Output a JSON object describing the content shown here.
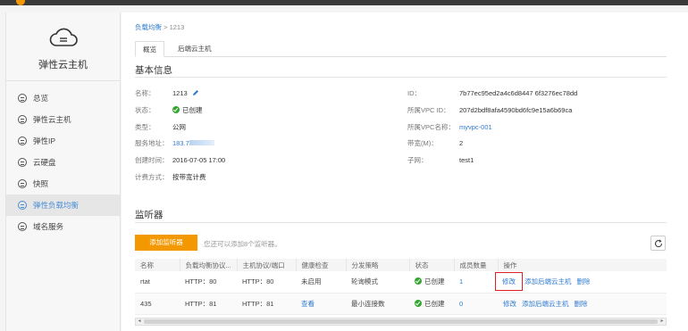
{
  "sidebar": {
    "title": "弹性云主机",
    "items": [
      {
        "label": "总览",
        "icon": "overview-icon"
      },
      {
        "label": "弹性云主机",
        "icon": "server-icon"
      },
      {
        "label": "弹性IP",
        "icon": "ip-icon"
      },
      {
        "label": "云硬盘",
        "icon": "disk-icon"
      },
      {
        "label": "快照",
        "icon": "snapshot-icon"
      },
      {
        "label": "弹性负载均衡",
        "icon": "load-balancer-icon",
        "active": true
      },
      {
        "label": "域名服务",
        "icon": "dns-icon"
      }
    ]
  },
  "breadcrumb": {
    "link": "负载均衡",
    "sep": " > ",
    "current": "1213"
  },
  "tabs": [
    {
      "label": "概览",
      "active": true
    },
    {
      "label": "后端云主机"
    }
  ],
  "basic_info": {
    "title": "基本信息",
    "name_k": "名称：",
    "name_v": "1213",
    "status_k": "状态：",
    "status_v": "已创建",
    "type_k": "类型：",
    "type_v": "公网",
    "addr_k": "服务地址：",
    "addr_v": "183.7",
    "created_k": "创建时间：",
    "created_v": "2016-07-05 17:00",
    "billing_k": "计费方式：",
    "billing_v": "按带宽计费",
    "id_k": "ID：",
    "id_v": "7b77ec95ed2a4c6d8447 6f3276ec78dd",
    "vpcid_k": "所属VPC ID：",
    "vpcid_v": "207d2bdf8afa4590bd6fc9e15a6b69ca",
    "vpcname_k": "所属VPC名称：",
    "vpcname_v": "myvpc-001",
    "bw_k": "带宽(M)：",
    "bw_v": "2",
    "subnet_k": "子网：",
    "subnet_v": "test1"
  },
  "listener": {
    "title": "监听器",
    "add_button": "添加监听器",
    "hint": "您还可以添加8个监听器。",
    "columns": [
      "名称",
      "负载均衡协议...",
      "主机协议/端口",
      "健康检查",
      "分发策略",
      "状态",
      "成员数量",
      "操作"
    ],
    "rows": [
      {
        "name": "rtat",
        "lb_proto": "HTTP：80",
        "host_proto": "HTTP：80",
        "health": "未启用",
        "policy": "轮询模式",
        "status": "已创建",
        "members": "1",
        "op_edit": "修改",
        "op_add": "添加后端云主机",
        "op_delete": "删除"
      },
      {
        "name": "435",
        "lb_proto": "HTTP：81",
        "host_proto": "HTTP：81",
        "health": "查看",
        "policy": "最小连接数",
        "status": "已创建",
        "members": "0",
        "op_edit": "修改",
        "op_add": "添加后端云主机",
        "op_delete": "删除"
      }
    ]
  }
}
